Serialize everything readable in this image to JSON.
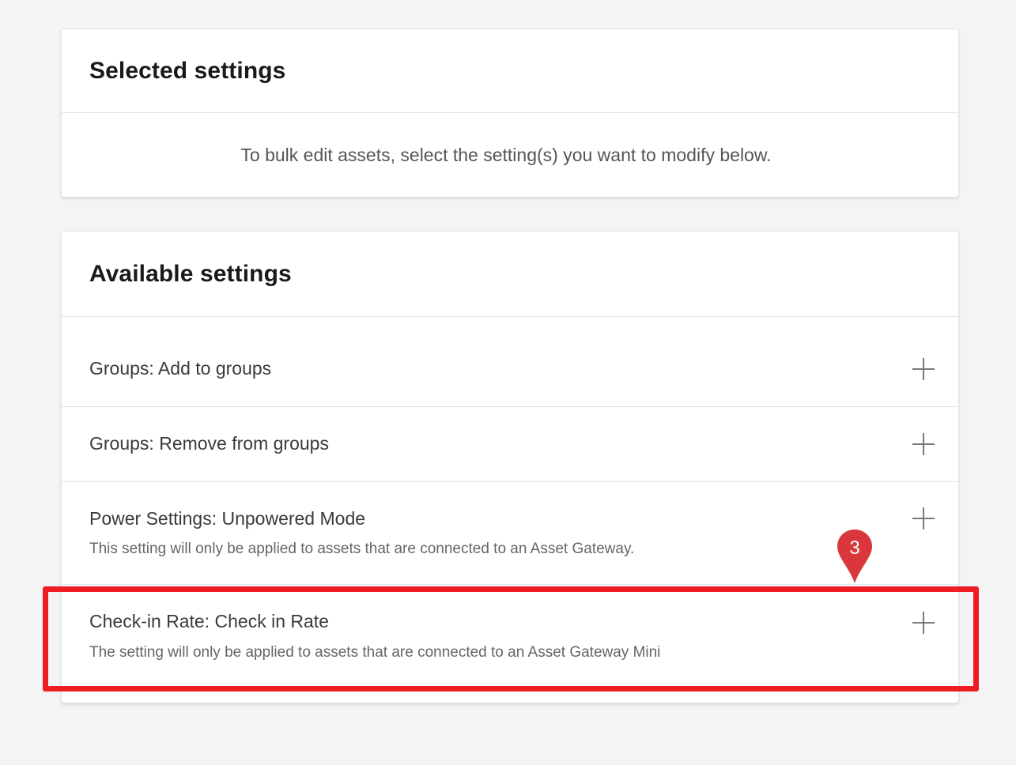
{
  "selected_settings": {
    "title": "Selected settings",
    "empty_message": "To bulk edit assets, select the setting(s) you want to modify below."
  },
  "available_settings": {
    "title": "Available settings",
    "items": [
      {
        "title": "Groups: Add to groups",
        "description": "",
        "icon": "plus-icon"
      },
      {
        "title": "Groups: Remove from groups",
        "description": "",
        "icon": "plus-icon"
      },
      {
        "title": "Power Settings: Unpowered Mode",
        "description": "This setting will only be applied to assets that are connected to an Asset Gateway.",
        "icon": "plus-icon"
      },
      {
        "title": "Check-in Rate: Check in Rate",
        "description": "The setting will only be applied to assets that are connected to an Asset Gateway Mini",
        "icon": "plus-icon"
      }
    ]
  },
  "annotation": {
    "marker_label": "3",
    "highlight_color": "#ee1d23",
    "marker_color": "#d9373b"
  }
}
